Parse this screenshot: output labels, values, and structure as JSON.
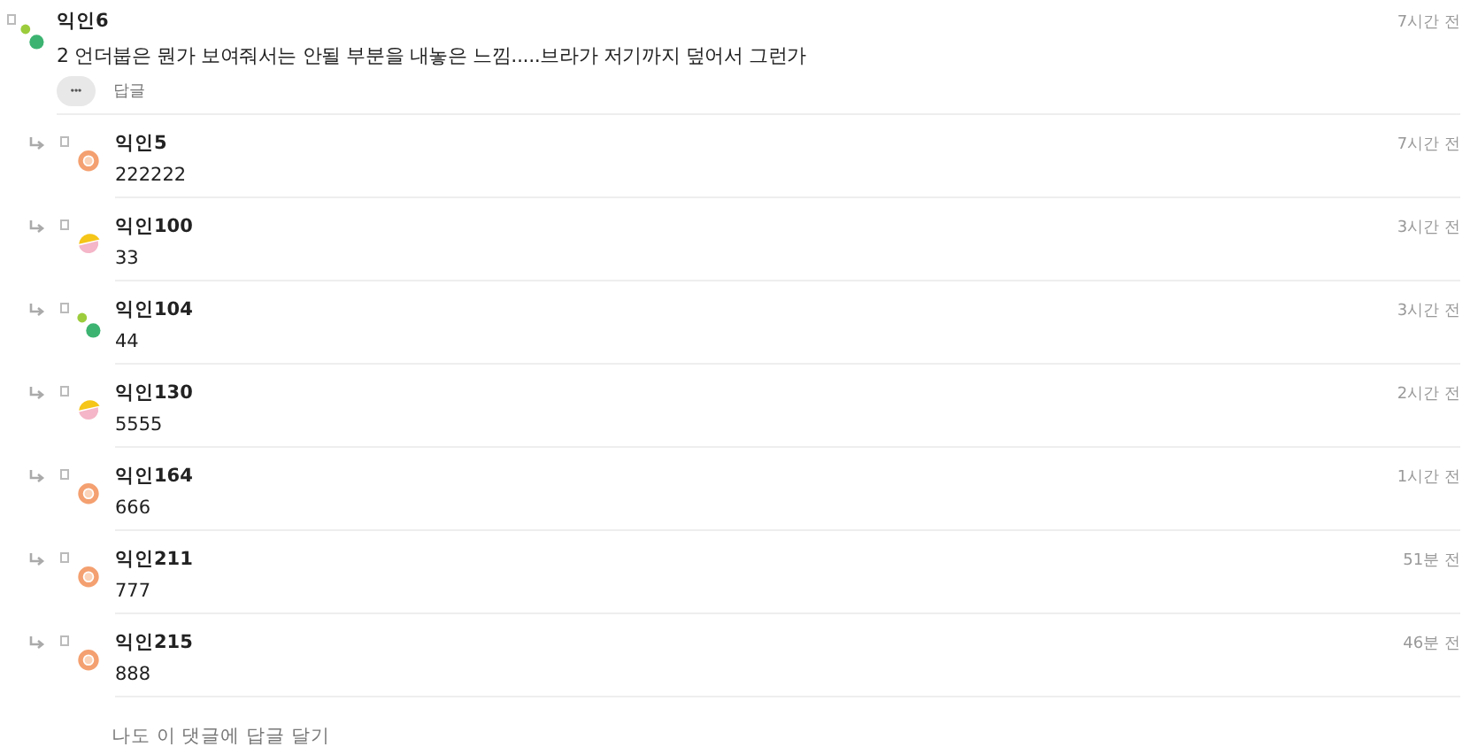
{
  "comment": {
    "author": "익인6",
    "kind": "dots",
    "time": "7시간 전",
    "text": "2 언더붑은 뭔가 보여줘서는 안될 부분을 내놓은 느낌.....브라가 저기까지 덮어서 그런가",
    "more": "•••",
    "reply_button": "답글"
  },
  "replies": [
    {
      "author": "익인5",
      "kind": "ring",
      "time": "7시간 전",
      "text": "222222"
    },
    {
      "author": "익인100",
      "kind": "halfmoon",
      "time": "3시간 전",
      "text": "33"
    },
    {
      "author": "익인104",
      "kind": "dots",
      "time": "3시간 전",
      "text": "44"
    },
    {
      "author": "익인130",
      "kind": "halfmoon",
      "time": "2시간 전",
      "text": "5555"
    },
    {
      "author": "익인164",
      "kind": "ring",
      "time": "1시간 전",
      "text": "666"
    },
    {
      "author": "익인211",
      "kind": "ring",
      "time": "51분 전",
      "text": "777"
    },
    {
      "author": "익인215",
      "kind": "ring",
      "time": "46분 전",
      "text": "888"
    }
  ],
  "reply_link": "나도 이 댓글에 답글 달기"
}
